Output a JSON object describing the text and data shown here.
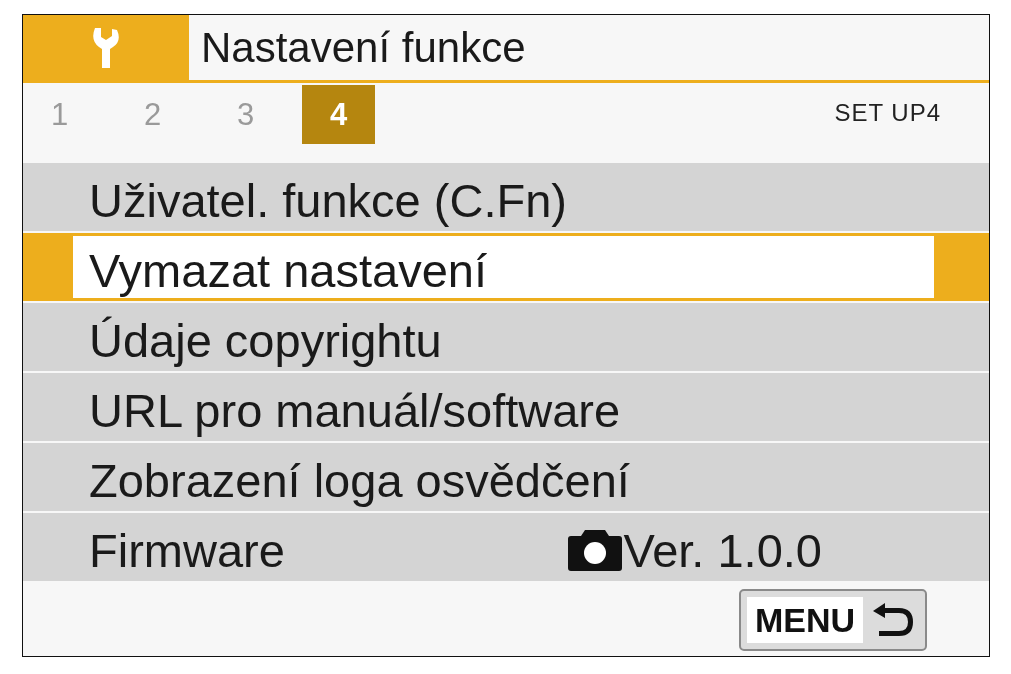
{
  "header": {
    "title": "Nastavení funkce"
  },
  "tabs": [
    {
      "label": "1",
      "selected": false
    },
    {
      "label": "2",
      "selected": false
    },
    {
      "label": "3",
      "selected": false
    },
    {
      "label": "4",
      "selected": true
    }
  ],
  "page_label": "SET UP4",
  "menu_items": [
    {
      "label": "Uživatel. funkce (C.Fn)",
      "selected": false
    },
    {
      "label": "Vymazat nastavení",
      "selected": true
    },
    {
      "label": "Údaje copyrightu",
      "selected": false
    },
    {
      "label": "URL pro manuál/software",
      "selected": false
    },
    {
      "label": "Zobrazení loga osvědčení",
      "selected": false
    },
    {
      "label": "Firmware",
      "value": "Ver. 1.0.0",
      "selected": false
    }
  ],
  "back_button": {
    "label": "MENU"
  }
}
